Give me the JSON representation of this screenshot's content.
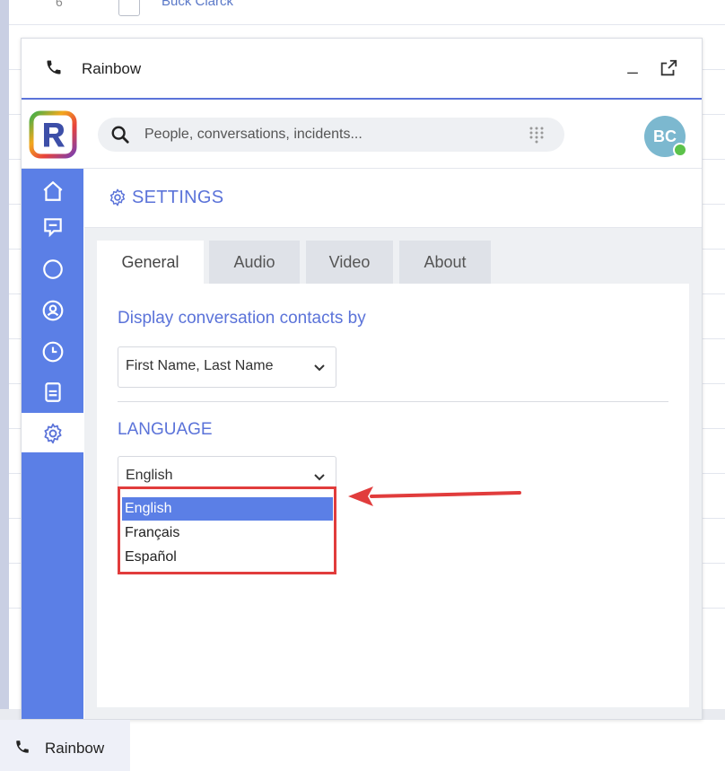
{
  "background": {
    "row_number": "6",
    "row_name": "Buck Clarck"
  },
  "window": {
    "title": "Rainbow",
    "minimize_label": "_",
    "icons": [
      "phone-icon",
      "popout-icon"
    ]
  },
  "search": {
    "placeholder": "People, conversations, incidents..."
  },
  "user": {
    "initials": "BC",
    "presence": "online"
  },
  "sidebar": {
    "items": [
      {
        "name": "home",
        "icon": "home-icon"
      },
      {
        "name": "conversations",
        "icon": "chat-icon"
      },
      {
        "name": "bubbles",
        "icon": "bubble-icon"
      },
      {
        "name": "contacts",
        "icon": "contact-icon"
      },
      {
        "name": "history",
        "icon": "clock-icon"
      },
      {
        "name": "files",
        "icon": "document-icon"
      },
      {
        "name": "settings",
        "icon": "gear-icon",
        "active": true
      }
    ]
  },
  "settings": {
    "header": "SETTINGS",
    "tabs": [
      {
        "label": "General",
        "active": true
      },
      {
        "label": "Audio"
      },
      {
        "label": "Video"
      },
      {
        "label": "About"
      }
    ],
    "display_contacts_label": "Display conversation contacts by",
    "display_contacts_value": "First Name, Last Name",
    "language_label": "LANGUAGE",
    "language_value": "English",
    "language_options": [
      "English",
      "Français",
      "Español"
    ],
    "language_selected": "English"
  },
  "taskbar": {
    "title": "Rainbow"
  },
  "colors": {
    "accent": "#5b73d9",
    "sidebar": "#5b7fe6",
    "highlight_box": "#e13c3c",
    "presence_online": "#5cc24a"
  }
}
